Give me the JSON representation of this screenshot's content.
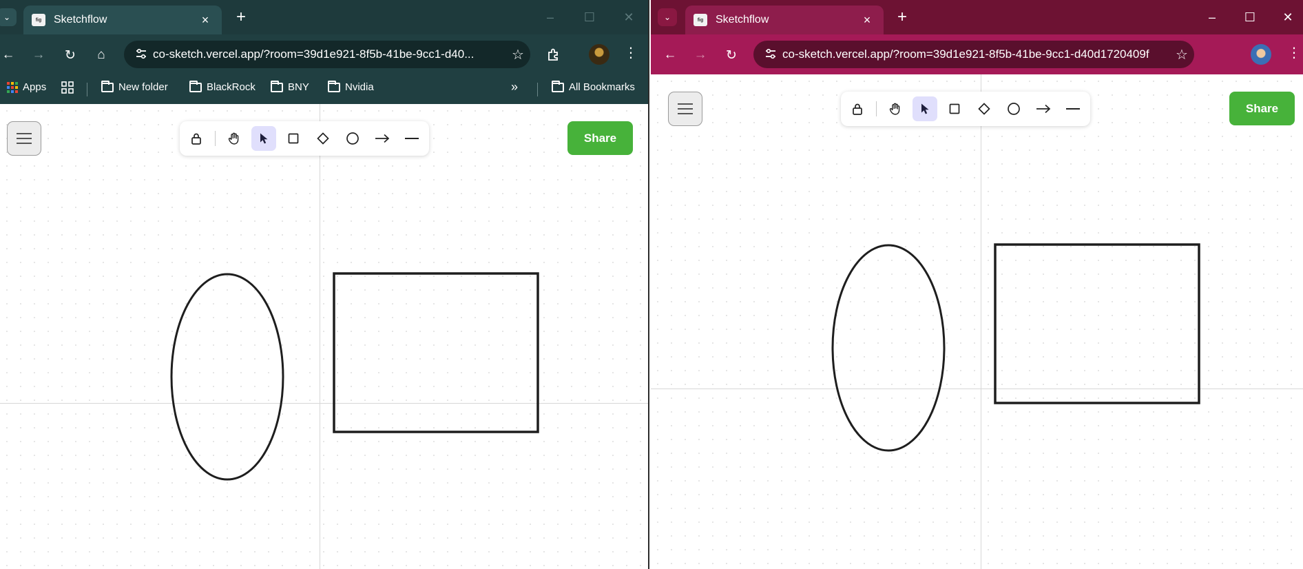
{
  "app": {
    "tab_title": "Sketchflow",
    "favicon_text": "fig"
  },
  "left_window": {
    "url": "co-sketch.vercel.app/?room=39d1e921-8f5b-41be-9cc1-d40...",
    "bookmarks": {
      "apps": "Apps",
      "folders": [
        "New folder",
        "BlackRock",
        "BNY",
        "Nvidia"
      ],
      "all_bookmarks": "All Bookmarks"
    }
  },
  "right_window": {
    "url": "co-sketch.vercel.app/?room=39d1e921-8f5b-41be-9cc1-d40d1720409f"
  },
  "canvas": {
    "share_label": "Share",
    "tools": [
      "lock",
      "hand",
      "select",
      "rectangle",
      "diamond",
      "ellipse",
      "arrow",
      "line"
    ],
    "active_tool": "select",
    "shapes": [
      "ellipse",
      "rectangle"
    ]
  },
  "icons": {
    "close": "×",
    "new_tab": "+",
    "minimize": "–",
    "maximize": "☐",
    "window_close": "✕",
    "back": "←",
    "forward": "→",
    "reload": "↻",
    "home": "⌂",
    "star": "☆",
    "more": "⋮",
    "chevron": "⌄",
    "overflow": "»"
  },
  "colors": {
    "left_frame": "#1e3a3c",
    "right_frame": "#a51a57",
    "share_green": "#47b23a",
    "active_tool_bg": "#e0dffc"
  }
}
